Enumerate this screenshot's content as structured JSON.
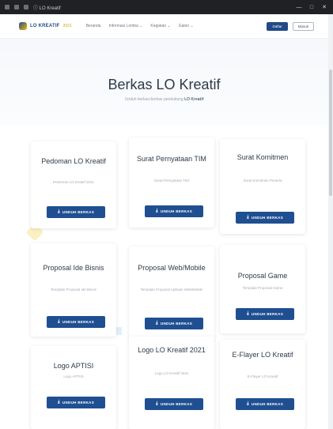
{
  "browser": {
    "title": "ⓘ LO Kreatif",
    "controls": [
      "—",
      "□",
      "✕"
    ]
  },
  "navbar": {
    "brand": "LO KREATIF",
    "brand_sub": "2021",
    "links": [
      "Beranda",
      "Informasi Lomba ⌄",
      "Kegiatan ⌄",
      "Galeri ⌄"
    ],
    "primary_button": "Daftar",
    "outline_button": "Masuk"
  },
  "hero": {
    "title": "Berkas LO Kreatif",
    "subtitle_prefix": "Unduh berkas-berkas pendukung ",
    "subtitle_bold": "LO Kreatif"
  },
  "cards": [
    {
      "title": "Pedoman LO Kreatif",
      "desc": "Pedoman LO Kreatif 2021"
    },
    {
      "title": "Surat Pernyataan TIM",
      "desc": "Surat Pernyataan TIM"
    },
    {
      "title": "Surat Komitmen",
      "desc": "Surat Komitmen Peserta"
    },
    {
      "title": "Proposal Ide Bisnis",
      "desc": "Template Proposal Ide Bisnis"
    },
    {
      "title": "Proposal Web/Mobile",
      "desc": "Template Proposal Aplikasi Web/Mobile"
    },
    {
      "title": "Proposal Game",
      "desc": "Template Proposal Game"
    },
    {
      "title": "Logo APTISI",
      "desc": "Logo APTISI"
    },
    {
      "title": "Logo LO Kreatif 2021",
      "desc": "Logo LO Kreatif 2021"
    },
    {
      "title": "E-Flayer LO Kreatif",
      "desc": "E-Flayer LO Kreatif"
    }
  ],
  "download_label": "UNDUH BERKAS",
  "colors": {
    "primary": "#1f4f91",
    "brand_accent": "#c9a400",
    "title_text": "#2e3a48"
  }
}
